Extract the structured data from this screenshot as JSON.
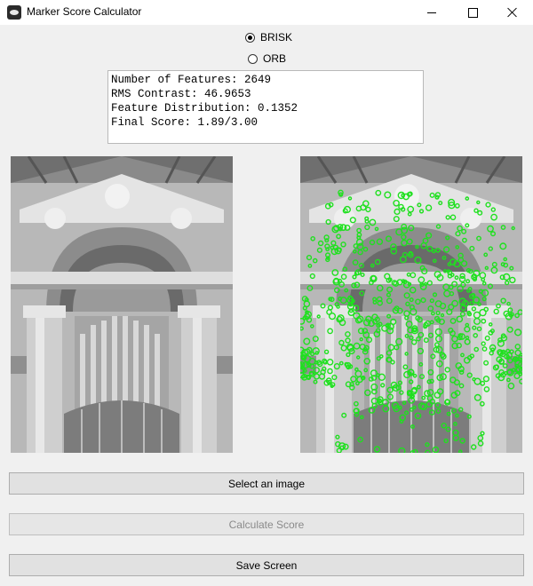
{
  "window": {
    "title": "Marker Score Calculator",
    "icon": "app-eye-icon",
    "controls": [
      "minimize-icon",
      "maximize-icon",
      "close-icon"
    ]
  },
  "detector": {
    "options": [
      {
        "label": "BRISK",
        "selected": true
      },
      {
        "label": "ORB",
        "selected": false
      }
    ]
  },
  "results": {
    "lines": [
      "Number of Features: 2649",
      "RMS Contrast: 46.9653",
      "Feature Distribution: 0.1352",
      "Final Score: 1.89/3.00"
    ]
  },
  "images": {
    "original": {
      "description": "grayscale-photo"
    },
    "features": {
      "description": "grayscale-photo-with-green-keypoints",
      "marker_color": "#1fe01f"
    }
  },
  "buttons": {
    "select_image": "Select an image",
    "calculate_score": "Calculate Score",
    "calculate_enabled": false,
    "save_screen": "Save Screen"
  }
}
